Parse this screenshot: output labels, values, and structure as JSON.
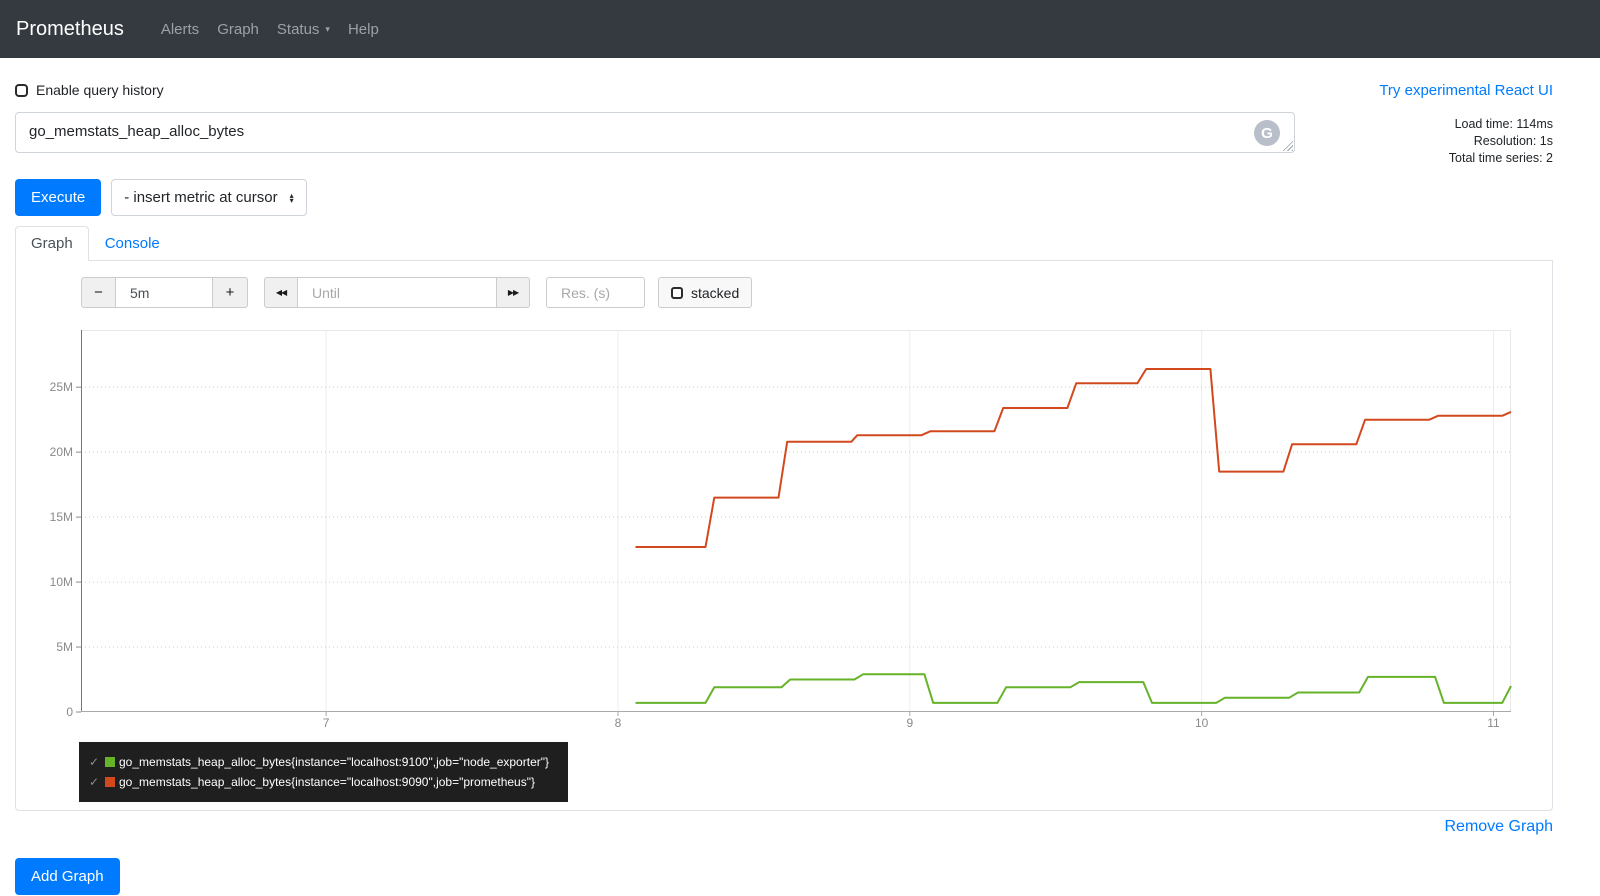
{
  "navbar": {
    "brand": "Prometheus",
    "items": [
      {
        "label": "Alerts",
        "caret": false
      },
      {
        "label": "Graph",
        "caret": false
      },
      {
        "label": "Status",
        "caret": true
      },
      {
        "label": "Help",
        "caret": false
      }
    ]
  },
  "query_history": {
    "label": "Enable query history",
    "checked": false
  },
  "react_ui_link": "Try experimental React UI",
  "query": {
    "value": "go_memstats_heap_alloc_bytes"
  },
  "icons": {
    "grammarly_icon": "G",
    "caret_up": "▴",
    "caret_down": "▾",
    "nav_caret": "▾",
    "check": "✓",
    "rewind": "◀◀",
    "forward": "▶▶"
  },
  "stats": {
    "load_time": "Load time: 114ms",
    "resolution": "Resolution: 1s",
    "total_series": "Total time series: 2"
  },
  "execute_label": "Execute",
  "insert_metric_selected": "- insert metric at cursor",
  "tabs": [
    {
      "label": "Graph",
      "active": true
    },
    {
      "label": "Console",
      "active": false
    }
  ],
  "controls": {
    "range_decrease": "−",
    "range_value": "5m",
    "range_increase": "+",
    "until_placeholder": "Until",
    "res_placeholder": "Res. (s)",
    "stacked_label": "stacked",
    "stacked_checked": false
  },
  "chart_data": {
    "type": "line",
    "title": "",
    "xlabel": "",
    "ylabel": "",
    "unit": "bytes (values in millions, M)",
    "grid": true,
    "legend_position": "bottom-left",
    "x_ticks": [
      7,
      8,
      9,
      10,
      11
    ],
    "y_tick_labels": [
      "0",
      "5M",
      "10M",
      "15M",
      "20M",
      "25M"
    ],
    "y_tick_values": [
      0,
      5,
      10,
      15,
      20,
      25
    ],
    "xlim": [
      6.16,
      11.06
    ],
    "ylim": [
      0,
      29.4
    ],
    "series": [
      {
        "name": "go_memstats_heap_alloc_bytes{instance=\"localhost:9100\",job=\"node_exporter\"}",
        "color": "#66b32a",
        "points": [
          [
            8.06,
            0.7
          ],
          [
            8.3,
            0.7
          ],
          [
            8.33,
            1.9
          ],
          [
            8.56,
            1.9
          ],
          [
            8.59,
            2.5
          ],
          [
            8.81,
            2.5
          ],
          [
            8.84,
            2.9
          ],
          [
            9.05,
            2.9
          ],
          [
            9.08,
            0.7
          ],
          [
            9.3,
            0.7
          ],
          [
            9.33,
            1.9
          ],
          [
            9.55,
            1.9
          ],
          [
            9.58,
            2.3
          ],
          [
            9.8,
            2.3
          ],
          [
            9.83,
            0.7
          ],
          [
            10.05,
            0.7
          ],
          [
            10.08,
            1.1
          ],
          [
            10.3,
            1.1
          ],
          [
            10.33,
            1.5
          ],
          [
            10.54,
            1.5
          ],
          [
            10.57,
            2.7
          ],
          [
            10.8,
            2.7
          ],
          [
            10.83,
            0.7
          ],
          [
            11.03,
            0.7
          ],
          [
            11.06,
            2.0
          ]
        ]
      },
      {
        "name": "go_memstats_heap_alloc_bytes{instance=\"localhost:9090\",job=\"prometheus\"}",
        "color": "#d2491e",
        "points": [
          [
            8.06,
            12.7
          ],
          [
            8.3,
            12.7
          ],
          [
            8.33,
            16.5
          ],
          [
            8.55,
            16.5
          ],
          [
            8.58,
            20.8
          ],
          [
            8.8,
            20.8
          ],
          [
            8.82,
            21.3
          ],
          [
            9.04,
            21.3
          ],
          [
            9.07,
            21.6
          ],
          [
            9.29,
            21.6
          ],
          [
            9.32,
            23.4
          ],
          [
            9.54,
            23.4
          ],
          [
            9.57,
            25.3
          ],
          [
            9.78,
            25.3
          ],
          [
            9.81,
            26.4
          ],
          [
            10.03,
            26.4
          ],
          [
            10.06,
            18.5
          ],
          [
            10.28,
            18.5
          ],
          [
            10.31,
            20.6
          ],
          [
            10.53,
            20.6
          ],
          [
            10.56,
            22.5
          ],
          [
            10.78,
            22.5
          ],
          [
            10.81,
            22.8
          ],
          [
            11.03,
            22.8
          ],
          [
            11.06,
            23.1
          ]
        ]
      }
    ]
  },
  "legend": {
    "items": [
      {
        "check": "✓",
        "color": "#66b32a",
        "label": "go_memstats_heap_alloc_bytes{instance=\"localhost:9100\",job=\"node_exporter\"}"
      },
      {
        "check": "✓",
        "color": "#d2491e",
        "label": "go_memstats_heap_alloc_bytes{instance=\"localhost:9090\",job=\"prometheus\"}"
      }
    ]
  },
  "remove_graph_label": "Remove Graph",
  "add_graph_label": "Add Graph",
  "colors": {
    "accent": "#007bff",
    "navbar_bg": "#343a40",
    "legend_bg": "#1f1f1f",
    "axis_label": "#8a8a8a"
  }
}
